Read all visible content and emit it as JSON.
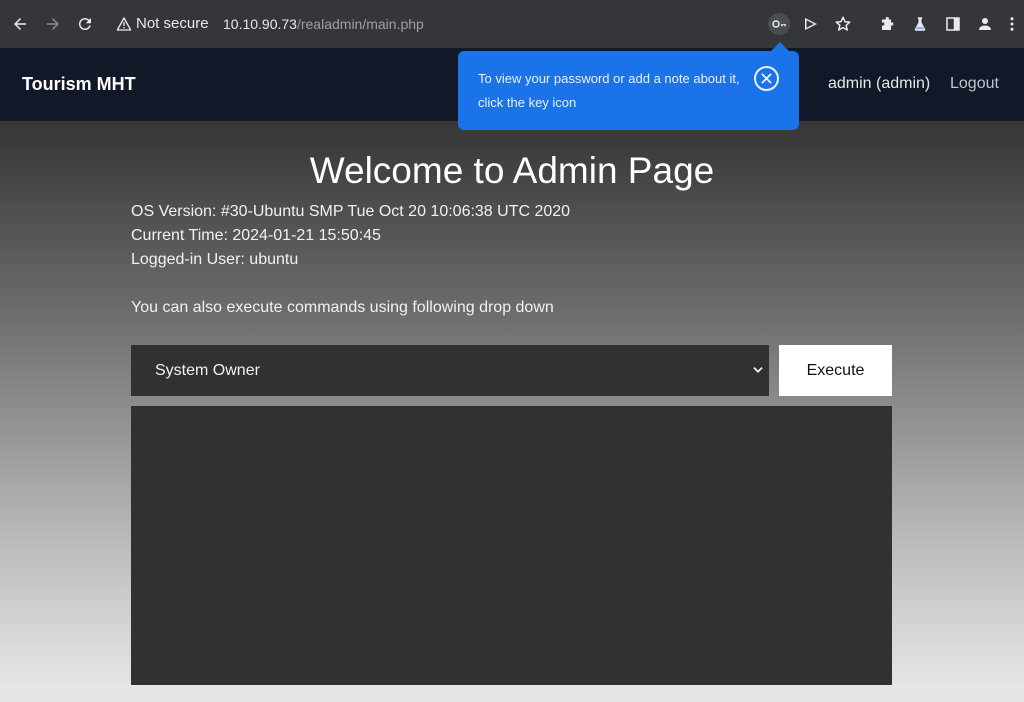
{
  "browser": {
    "security_label": "Not secure",
    "url_host": "10.10.90.73",
    "url_path": "/realadmin/main.php"
  },
  "password_bubble": {
    "message": "To view your password or add a note about it, click the key icon"
  },
  "site": {
    "brand": "Tourism MHT",
    "user_label": "admin (admin)",
    "logout_label": "Logout"
  },
  "main": {
    "title": "Welcome to Admin Page",
    "os_version": "OS Version: #30-Ubuntu SMP Tue Oct 20 10:06:38 UTC 2020",
    "current_time": "Current Time: 2024-01-21 15:50:45",
    "logged_in_user": "Logged-in User: ubuntu",
    "prompt": "You can also execute commands using following drop down",
    "command_select_value": "System Owner",
    "execute_label": "Execute",
    "output": ""
  },
  "colors": {
    "chrome": "#35363a",
    "navbar": "#111827",
    "bubble": "#1a73e8",
    "panel": "#313131"
  }
}
